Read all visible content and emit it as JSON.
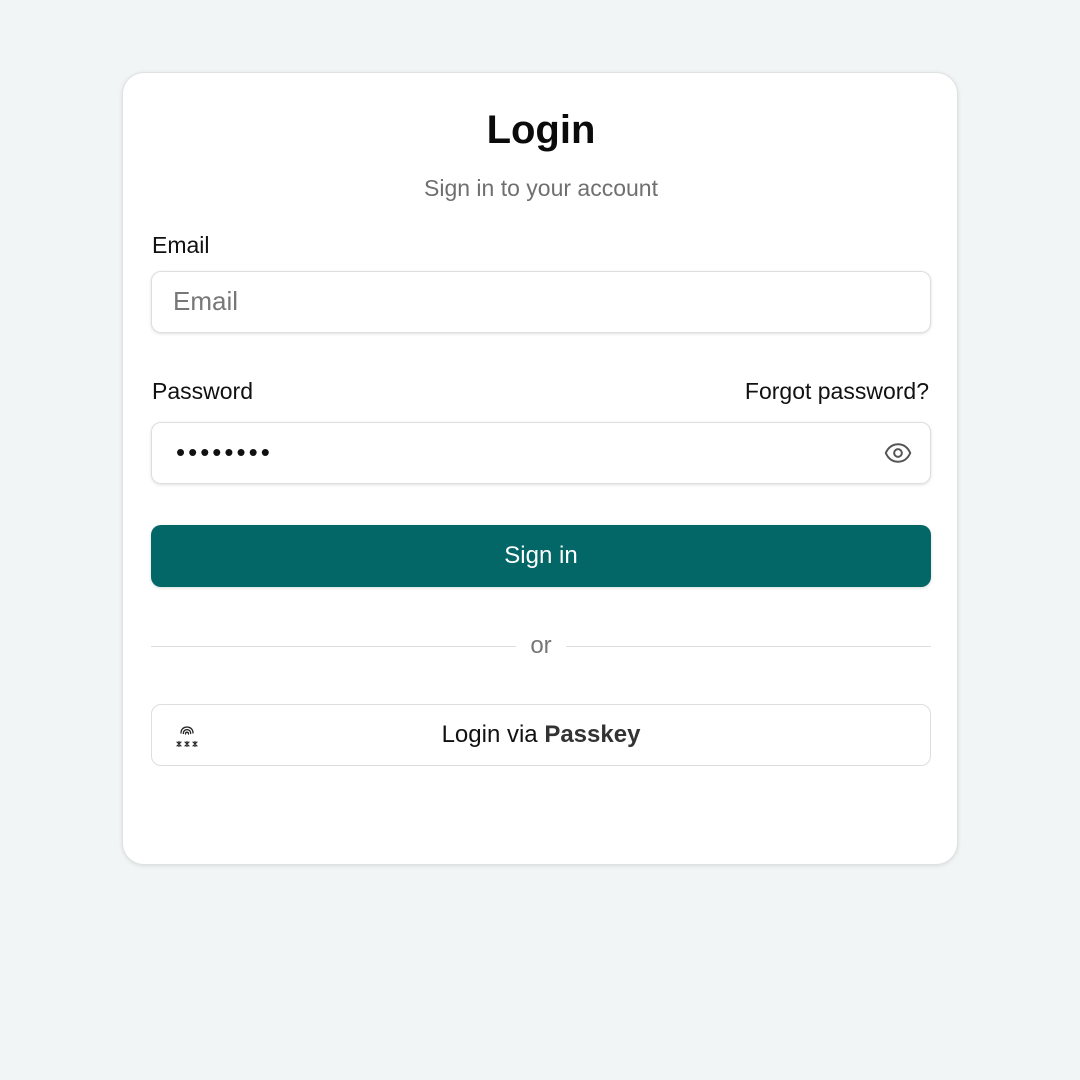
{
  "login": {
    "title": "Login",
    "subtitle": "Sign in to your account",
    "email_label": "Email",
    "email_placeholder": "Email",
    "email_value": "",
    "password_label": "Password",
    "password_masked": "••••••••",
    "forgot_label": "Forgot password?",
    "signin_label": "Sign in",
    "divider_label": "or",
    "passkey_prefix": "Login via ",
    "passkey_strong": "Passkey"
  },
  "icons": {
    "show_password": "eye-icon",
    "passkey": "passkey-fingerprint-icon"
  },
  "colors": {
    "background": "#f1f5f5",
    "primary": "#026766",
    "card": "#ffffff",
    "muted_text": "#6f6f6f"
  }
}
